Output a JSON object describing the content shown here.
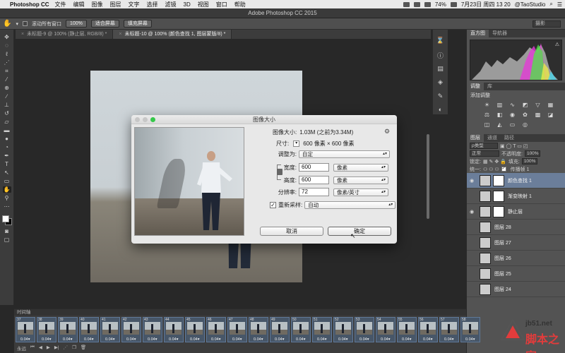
{
  "menubar": {
    "app_name": "Photoshop CC",
    "items": [
      "文件",
      "编辑",
      "图像",
      "图层",
      "文字",
      "选择",
      "滤镜",
      "3D",
      "视图",
      "窗口",
      "帮助"
    ],
    "battery": "74%",
    "datetime": "7月23日 周四  13 20",
    "user": "@TaoStudio"
  },
  "window": {
    "title": "Adobe Photoshop CC 2015"
  },
  "options_bar": {
    "scroll_all_label": "滚动所有窗口",
    "zoom_100_label": "100%",
    "fit_screen_label": "适合屏幕",
    "fill_screen_label": "填充屏幕",
    "workspace": "摄影"
  },
  "tabs": [
    {
      "label": "未标题-9 @ 100% (静止层, RGB/8) *"
    },
    {
      "label": "未标题-10 @ 100% (颜色查找 1, 图层蒙版/8) *"
    }
  ],
  "dialog": {
    "title": "图像大小",
    "image_size_label": "图像大小:",
    "image_size_value": "1.03M (之前为3.34M)",
    "dimensions_label": "尺寸:",
    "dimensions_value": "600 像素  ×  600 像素",
    "fit_to_label": "调整为:",
    "fit_to_value": "自定",
    "width_label": "宽度:",
    "width_value": "600",
    "width_unit": "像素",
    "height_label": "高度:",
    "height_value": "600",
    "height_unit": "像素",
    "resolution_label": "分辨率:",
    "resolution_value": "72",
    "resolution_unit": "像素/英寸",
    "resample_label": "重新采样:",
    "resample_value": "自动",
    "cancel_label": "取消",
    "ok_label": "确定"
  },
  "panels": {
    "histogram_tabs": [
      "直方图",
      "导航器"
    ],
    "adjust_tabs": [
      "调整",
      "库"
    ],
    "add_adjustment_label": "添加调整",
    "layers_tabs": [
      "图层",
      "通道",
      "路径"
    ],
    "kind_label": "ρ类型",
    "blend_mode": "正常",
    "opacity_label": "不透明度:",
    "opacity_value": "100%",
    "lock_label": "锁定:",
    "fill_label": "填充:",
    "fill_value": "100%",
    "propagate_label": "传播帧 1",
    "layers": [
      {
        "name": "颜色查找 1",
        "selected": true
      },
      {
        "name": "渐变映射 1",
        "selected": false
      },
      {
        "name": "静止层",
        "selected": false
      },
      {
        "name": "图层 28",
        "selected": false
      },
      {
        "name": "图层 27",
        "selected": false
      },
      {
        "name": "图层 26",
        "selected": false
      },
      {
        "name": "图层 25",
        "selected": false
      },
      {
        "name": "图层 24",
        "selected": false
      }
    ]
  },
  "timeline": {
    "title": "时间轴",
    "loop": "永远",
    "frames": [
      {
        "num": "37",
        "dur": "0.04▾"
      },
      {
        "num": "38",
        "dur": "0.04▾"
      },
      {
        "num": "39",
        "dur": "0.04▾"
      },
      {
        "num": "40",
        "dur": "0.04▾"
      },
      {
        "num": "41",
        "dur": "0.04▾"
      },
      {
        "num": "42",
        "dur": "0.04▾"
      },
      {
        "num": "43",
        "dur": "0.04▾"
      },
      {
        "num": "44",
        "dur": "0.04▾"
      },
      {
        "num": "45",
        "dur": "0.04▾"
      },
      {
        "num": "46",
        "dur": "0.04▾"
      },
      {
        "num": "47",
        "dur": "0.04▾"
      },
      {
        "num": "48",
        "dur": "0.04▾"
      },
      {
        "num": "49",
        "dur": "0.04▾"
      },
      {
        "num": "50",
        "dur": "0.04▾"
      },
      {
        "num": "51",
        "dur": "0.04▾"
      },
      {
        "num": "52",
        "dur": "0.04▾"
      },
      {
        "num": "53",
        "dur": "0.04▾"
      },
      {
        "num": "54",
        "dur": "0.04▾"
      },
      {
        "num": "55",
        "dur": "0.04▾"
      },
      {
        "num": "56",
        "dur": "0.04▾"
      },
      {
        "num": "57",
        "dur": "0.04▾"
      },
      {
        "num": "58",
        "dur": "0.04▾"
      }
    ]
  },
  "watermark": {
    "url": "jb51.net",
    "name": "脚本之家"
  }
}
